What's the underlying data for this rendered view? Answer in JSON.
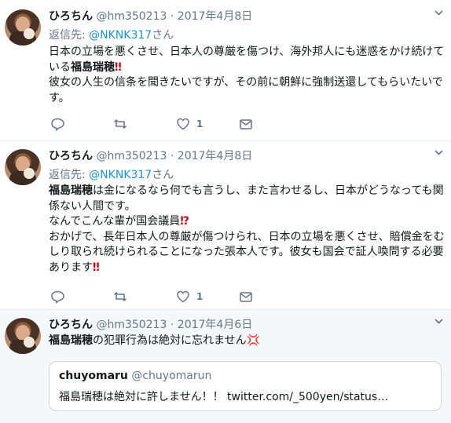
{
  "tweets": [
    {
      "name": "ひろちん",
      "handle": "@hm350213",
      "separator": "·",
      "date": "2017年4月8日",
      "reply_prefix": "返信先:",
      "reply_handle": "@NKNK317",
      "reply_suffix": "さん",
      "text_lines": [
        "日本の立場を悪くさせ、日本人の尊厳を傷つけ、海外邦人にも迷惑をかけ続けて",
        "いる"
      ],
      "text_bold": "福島瑞穂",
      "text_emoji": "‼",
      "text_rest": [
        "彼女の人生の信条を聞きたいですが、その前に朝鮮に強制送還してもらいたいで",
        "す。"
      ],
      "likes": "1"
    },
    {
      "name": "ひろちん",
      "handle": "@hm350213",
      "separator": "·",
      "date": "2017年4月8日",
      "reply_prefix": "返信先:",
      "reply_handle": "@NKNK317",
      "reply_suffix": "さん",
      "text_bold": "福島瑞穂",
      "text_a": "は金になるなら何でも言うし、また言わせるし、日本がどうなっても関",
      "text_b": "係ない人間です。",
      "text_c": "なんでこんな輩が国会議員",
      "text_c_emoji": "⁉",
      "text_d": "おかげで、長年日本人の尊厳が傷つけられ、日本の立場を悪くさせ、賠償金をむ",
      "text_e": "しり取られ続けられることになった張本人です。彼女も国会で証人喚問する必要",
      "text_f": "あります",
      "text_f_emoji": "‼",
      "likes": "1"
    },
    {
      "name": "ひろちん",
      "handle": "@hm350213",
      "separator": "·",
      "date": "2017年4月6日",
      "text_bold": "福島瑞穂",
      "text_a": "の犯罪行為は絶対に忘れません",
      "text_emoji": "💢",
      "quote": {
        "name": "chuyomaru",
        "handle": "@chuyomarun",
        "text": "福島瑞穂は絶対に許しません！！ twitter.com/_500yen/status…"
      }
    }
  ],
  "icons": [
    "reply-icon",
    "retweet-icon",
    "like-icon",
    "dm-icon",
    "chevron-down-icon"
  ],
  "colors": {
    "link": "#1b95e0",
    "muted": "#657786",
    "border": "#e6ecf0"
  }
}
